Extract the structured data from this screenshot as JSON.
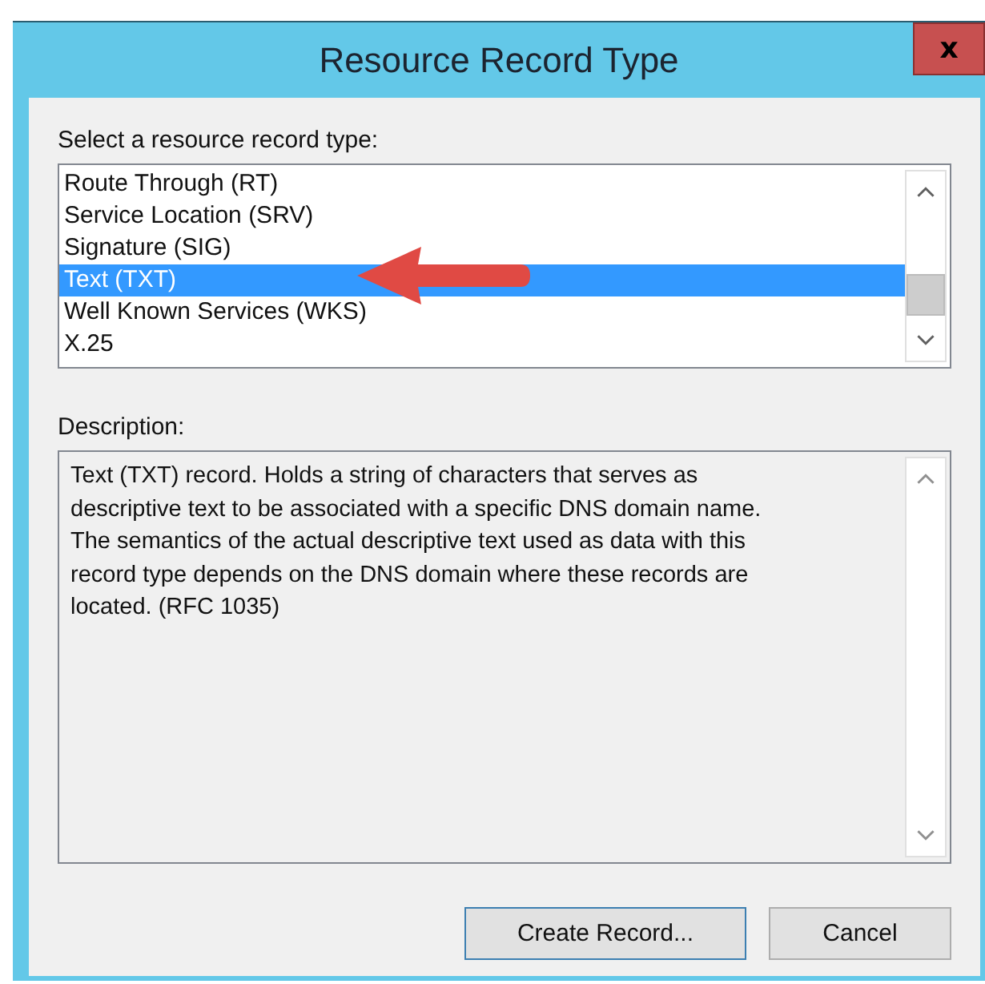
{
  "window": {
    "title": "Resource Record Type",
    "close": "x"
  },
  "list_label": "Select a resource record type:",
  "record_types": [
    {
      "label": "Route Through (RT)",
      "selected": false
    },
    {
      "label": "Service Location (SRV)",
      "selected": false
    },
    {
      "label": "Signature (SIG)",
      "selected": false
    },
    {
      "label": "Text (TXT)",
      "selected": true
    },
    {
      "label": "Well Known Services (WKS)",
      "selected": false
    },
    {
      "label": "X.25",
      "selected": false
    }
  ],
  "description_label": "Description:",
  "description_lines": [
    "Text (TXT) record. Holds a string of characters that serves as",
    "descriptive text to be associated with a specific DNS domain name.",
    "The semantics of the actual descriptive text used as data with this",
    "record type depends on the DNS domain where these records are",
    "located. (RFC 1035)"
  ],
  "buttons": [
    {
      "label": "Create Record...",
      "default": true
    },
    {
      "label": "Cancel",
      "default": false
    }
  ]
}
